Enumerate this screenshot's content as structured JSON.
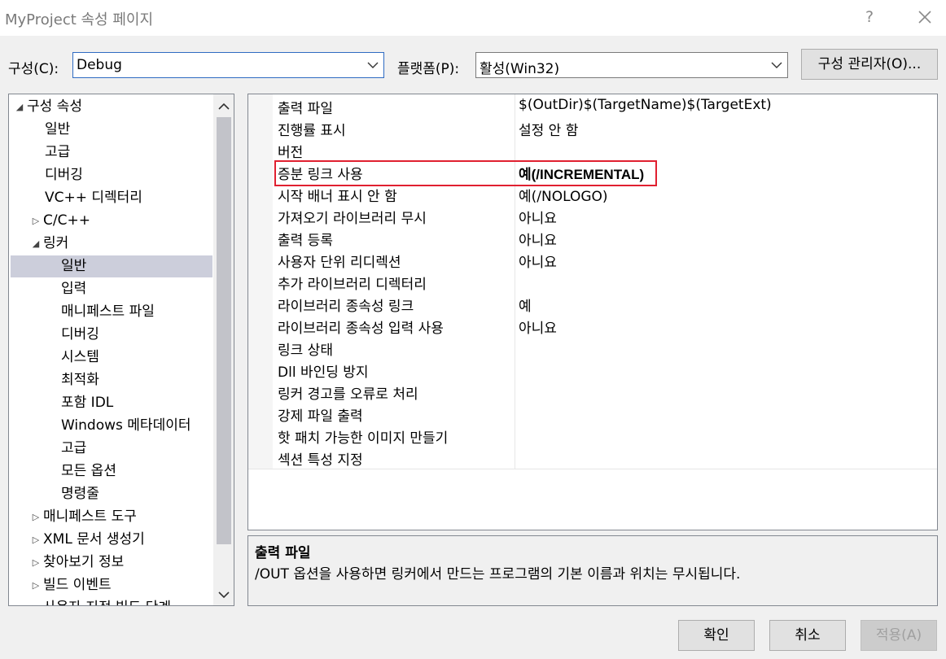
{
  "window": {
    "title": "MyProject 속성 페이지",
    "help": "?"
  },
  "toolbar": {
    "config_label": "구성(C):",
    "config_value": "Debug",
    "platform_label": "플랫폼(P):",
    "platform_value": "활성(Win32)",
    "manager_label": "구성 관리자(O)..."
  },
  "tree": {
    "items": [
      {
        "label": "구성 속성",
        "expander": "◢"
      },
      {
        "label": "일반"
      },
      {
        "label": "고급"
      },
      {
        "label": "디버깅"
      },
      {
        "label": "VC++ 디렉터리"
      },
      {
        "label": "C/C++",
        "expander": "▷"
      },
      {
        "label": "링커",
        "expander": "◢"
      },
      {
        "label": "일반",
        "selected": true
      },
      {
        "label": "입력"
      },
      {
        "label": "매니페스트 파일"
      },
      {
        "label": "디버깅"
      },
      {
        "label": "시스템"
      },
      {
        "label": "최적화"
      },
      {
        "label": "포함 IDL"
      },
      {
        "label": "Windows 메타데이터"
      },
      {
        "label": "고급"
      },
      {
        "label": "모든 옵션"
      },
      {
        "label": "명령줄"
      },
      {
        "label": "매니페스트 도구",
        "expander": "▷"
      },
      {
        "label": "XML 문서 생성기",
        "expander": "▷"
      },
      {
        "label": "찾아보기 정보",
        "expander": "▷"
      },
      {
        "label": "빌드 이벤트",
        "expander": "▷"
      },
      {
        "label": "사용자 지정 빌드 단계",
        "expander": "▷"
      }
    ]
  },
  "properties": [
    {
      "name": "출력 파일",
      "value": "$(OutDir)$(TargetName)$(TargetExt)"
    },
    {
      "name": "진행률 표시",
      "value": "설정 안 함"
    },
    {
      "name": "버전",
      "value": ""
    },
    {
      "name": "증분 링크 사용",
      "value": "예(/INCREMENTAL)",
      "bold": true
    },
    {
      "name": "시작 배너 표시 안 함",
      "value": "예(/NOLOGO)"
    },
    {
      "name": "가져오기 라이브러리 무시",
      "value": "아니요"
    },
    {
      "name": "출력 등록",
      "value": "아니요"
    },
    {
      "name": "사용자 단위 리디렉션",
      "value": "아니요"
    },
    {
      "name": "추가 라이브러리 디렉터리",
      "value": ""
    },
    {
      "name": "라이브러리 종속성 링크",
      "value": "예"
    },
    {
      "name": "라이브러리 종속성 입력 사용",
      "value": "아니요"
    },
    {
      "name": "링크 상태",
      "value": ""
    },
    {
      "name": "Dll 바인딩 방지",
      "value": ""
    },
    {
      "name": "링커 경고를 오류로 처리",
      "value": ""
    },
    {
      "name": "강제 파일 출력",
      "value": ""
    },
    {
      "name": "핫 패치 가능한 이미지 만들기",
      "value": ""
    },
    {
      "name": "섹션 특성 지정",
      "value": ""
    }
  ],
  "description": {
    "title": "출력 파일",
    "text": "/OUT 옵션을 사용하면 링커에서 만드는 프로그램의 기본 이름과 위치는 무시됩니다."
  },
  "buttons": {
    "ok": "확인",
    "cancel": "취소",
    "apply": "적용(A)"
  },
  "colors": {
    "highlight": "#e02030",
    "selection": "#cccedb",
    "focus": "#2f6bc2"
  }
}
